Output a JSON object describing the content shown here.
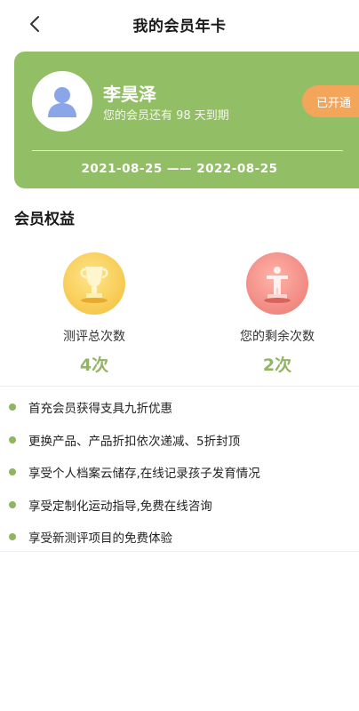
{
  "header": {
    "title": "我的会员年卡",
    "back_icon": "chevron-left-icon"
  },
  "card": {
    "background": "#92be65",
    "user_name": "李昊泽",
    "expire_text": "您的会员还有 98 天到期",
    "status_label": "已开通",
    "date_range": "2021-08-25 —— 2022-08-25",
    "avatar_icon": "user-avatar-icon"
  },
  "section": {
    "title": "会员权益"
  },
  "stats": [
    {
      "label": "测评总次数",
      "value": "4次",
      "icon": "trophy-cup-icon"
    },
    {
      "label": "您的剩余次数",
      "value": "2次",
      "icon": "podium-figure-icon"
    }
  ],
  "benefits": [
    "首充会员获得支具九折优惠",
    "更换产品、产品折扣依次递减、5折封顶",
    "享受个人档案云储存,在线记录孩子发育情况",
    "享受定制化运动指导,免费在线咨询",
    "享受新测评项目的免费体验"
  ],
  "colors": {
    "accent_green": "#92be65",
    "value_green": "#93b463",
    "status_orange": "#f3a65a"
  }
}
